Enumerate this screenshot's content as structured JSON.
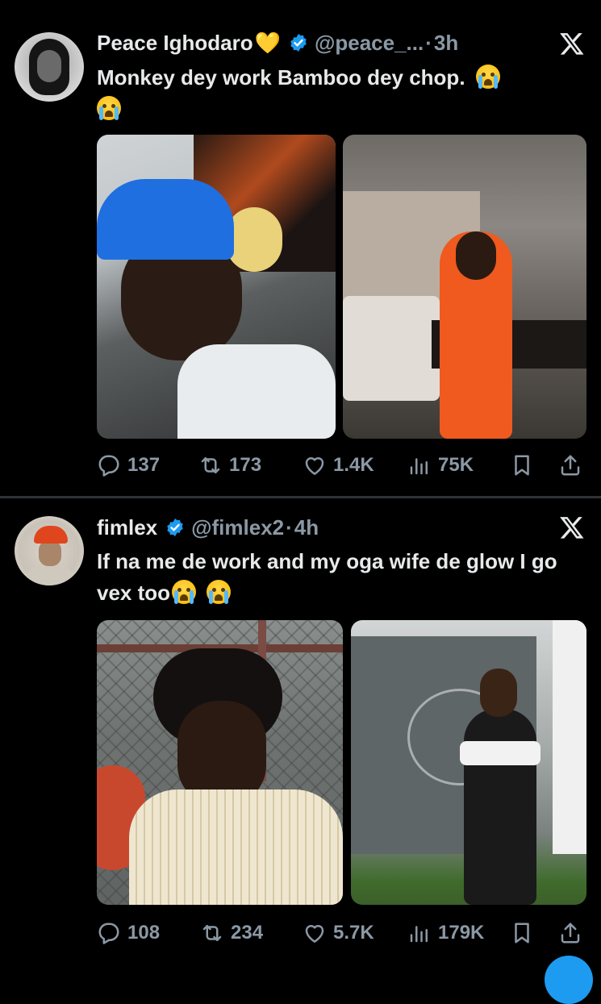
{
  "colors": {
    "background": "#000000",
    "text_primary": "#e7e9ea",
    "text_secondary": "#8b98a5",
    "verified_blue": "#1d9bf0",
    "divider": "#2f3336"
  },
  "tweets": [
    {
      "display_name": "Peace Ighodaro",
      "name_emoji": "💛",
      "handle": "@peace_...",
      "separator": "·",
      "time": "3h",
      "verified": true,
      "text": "Monkey dey work Bamboo dey chop.",
      "text_emoji": "crying-face",
      "media_count": 2,
      "stats": {
        "replies": "137",
        "reposts": "173",
        "likes": "1.4K",
        "views": "75K"
      }
    },
    {
      "display_name": "fimlex",
      "handle": "@fimlex2",
      "separator": "·",
      "time": "4h",
      "verified": true,
      "text": "If na me de work and my oga wife de glow I go vex too",
      "text_emoji": "crying-face",
      "media_count": 2,
      "stats": {
        "replies": "108",
        "reposts": "234",
        "likes": "5.7K",
        "views": "179K"
      }
    }
  ],
  "icons": {
    "reply": "reply-icon",
    "repost": "repost-icon",
    "like": "like-icon",
    "views": "views-icon",
    "bookmark": "bookmark-icon",
    "share": "share-icon",
    "platform": "x-logo-icon",
    "verified": "verified-badge-icon"
  }
}
